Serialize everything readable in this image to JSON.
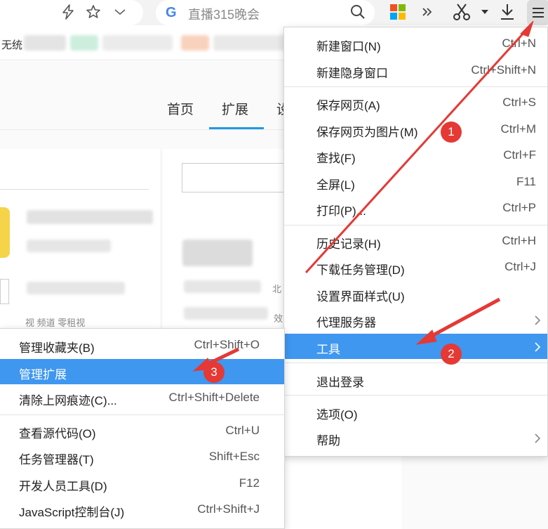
{
  "toolbar": {
    "search_logo": "G",
    "search_placeholder": "直播315晚会",
    "icons": [
      "lightning-icon",
      "star-icon",
      "chevron-down-icon",
      "search-icon",
      "apps-grid-icon",
      "double-chevron-icon",
      "scissors-icon",
      "download-icon",
      "hamburger-menu-icon"
    ]
  },
  "bookmarks": {
    "first_label": "无统"
  },
  "page": {
    "tabs": [
      "首页",
      "扩展",
      "设"
    ],
    "active_tab": "扩展",
    "fragments": [
      "视  频道  零租视",
      "北",
      "效"
    ]
  },
  "main_menu": {
    "groups": [
      [
        {
          "label": "新建窗口(N)",
          "shortcut": "Ctrl+N"
        },
        {
          "label": "新建隐身窗口",
          "shortcut": "Ctrl+Shift+N"
        }
      ],
      [
        {
          "label": "保存网页(A)",
          "shortcut": "Ctrl+S"
        },
        {
          "label": "保存网页为图片(M)",
          "shortcut": "Ctrl+M"
        },
        {
          "label": "查找(F)",
          "shortcut": "Ctrl+F"
        },
        {
          "label": "全屏(L)",
          "shortcut": "F11"
        },
        {
          "label": "打印(P)...",
          "shortcut": "Ctrl+P"
        }
      ],
      [
        {
          "label": "历史记录(H)",
          "shortcut": "Ctrl+H"
        },
        {
          "label": "下载任务管理(D)",
          "shortcut": "Ctrl+J"
        },
        {
          "label": "设置界面样式(U)",
          "shortcut": ""
        },
        {
          "label": "代理服务器",
          "shortcut": "",
          "submenu": true
        },
        {
          "label": "工具",
          "shortcut": "",
          "submenu": true,
          "highlighted": true
        }
      ],
      [
        {
          "label": "退出登录",
          "shortcut": ""
        }
      ],
      [
        {
          "label": "选项(O)",
          "shortcut": ""
        },
        {
          "label": "帮助",
          "shortcut": "",
          "submenu": true
        }
      ]
    ]
  },
  "tools_submenu": {
    "groups": [
      [
        {
          "label": "管理收藏夹(B)",
          "shortcut": "Ctrl+Shift+O"
        },
        {
          "label": "管理扩展",
          "shortcut": "",
          "highlighted": true
        },
        {
          "label": "清除上网痕迹(C)...",
          "shortcut": "Ctrl+Shift+Delete"
        }
      ],
      [
        {
          "label": "查看源代码(O)",
          "shortcut": "Ctrl+U"
        },
        {
          "label": "任务管理器(T)",
          "shortcut": "Shift+Esc"
        },
        {
          "label": "开发人员工具(D)",
          "shortcut": "F12"
        },
        {
          "label": "JavaScript控制台(J)",
          "shortcut": "Ctrl+Shift+J"
        }
      ]
    ]
  },
  "annotations": {
    "badges": [
      "1",
      "2",
      "3"
    ],
    "color": "#e53935"
  },
  "colors": {
    "highlight": "#3f97f0",
    "active_tab_underline": "#1e9be7",
    "annotation": "#e53935"
  }
}
